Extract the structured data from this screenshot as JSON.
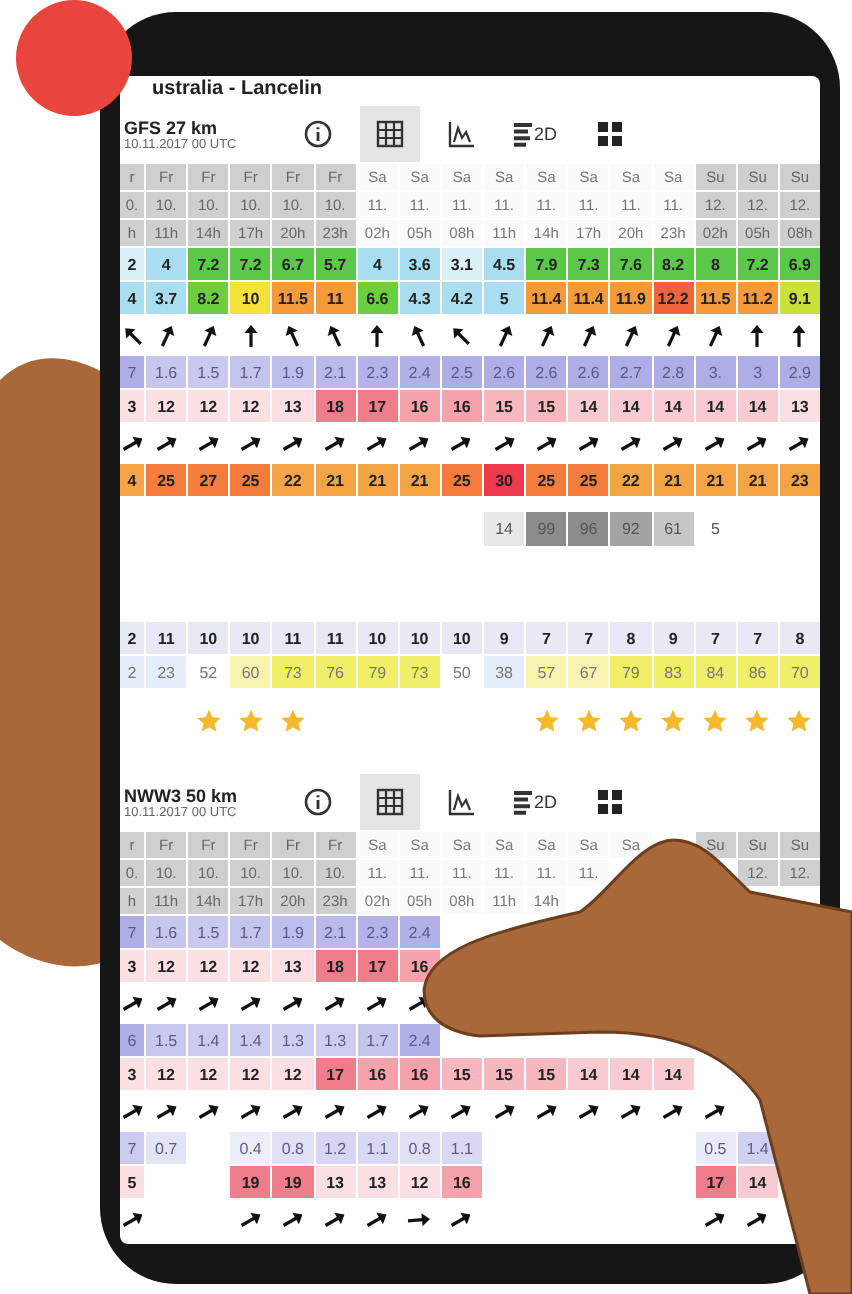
{
  "title": "ustralia - Lancelin",
  "blocks": [
    {
      "model": "GFS 27 km",
      "run": "10.11.2017 00 UTC",
      "tools": [
        {
          "kind": "info",
          "selected": false
        },
        {
          "kind": "table",
          "selected": true
        },
        {
          "kind": "chart",
          "selected": false
        },
        {
          "kind": "bars",
          "label": "2D",
          "selected": false
        },
        {
          "kind": "tiles",
          "selected": false
        }
      ],
      "columns": [
        {
          "day": "r",
          "date": "0.",
          "hour": "h",
          "shaded": true
        },
        {
          "day": "Fr",
          "date": "10.",
          "hour": "11h",
          "shaded": true
        },
        {
          "day": "Fr",
          "date": "10.",
          "hour": "14h",
          "shaded": true
        },
        {
          "day": "Fr",
          "date": "10.",
          "hour": "17h",
          "shaded": true
        },
        {
          "day": "Fr",
          "date": "10.",
          "hour": "20h",
          "shaded": true
        },
        {
          "day": "Fr",
          "date": "10.",
          "hour": "23h",
          "shaded": true
        },
        {
          "day": "Sa",
          "date": "11.",
          "hour": "02h",
          "shaded": false
        },
        {
          "day": "Sa",
          "date": "11.",
          "hour": "05h",
          "shaded": false
        },
        {
          "day": "Sa",
          "date": "11.",
          "hour": "08h",
          "shaded": false
        },
        {
          "day": "Sa",
          "date": "11.",
          "hour": "11h",
          "shaded": false
        },
        {
          "day": "Sa",
          "date": "11.",
          "hour": "14h",
          "shaded": false
        },
        {
          "day": "Sa",
          "date": "11.",
          "hour": "17h",
          "shaded": false
        },
        {
          "day": "Sa",
          "date": "11.",
          "hour": "20h",
          "shaded": false
        },
        {
          "day": "Sa",
          "date": "11.",
          "hour": "23h",
          "shaded": false
        },
        {
          "day": "Su",
          "date": "12.",
          "hour": "02h",
          "shaded": true
        },
        {
          "day": "Su",
          "date": "12.",
          "hour": "05h",
          "shaded": true
        },
        {
          "day": "Su",
          "date": "12.",
          "hour": "08h",
          "shaded": true
        }
      ],
      "rows": [
        {
          "kind": "wind",
          "cells": [
            "2",
            "4",
            "7.2",
            "7.2",
            "6.7",
            "5.7",
            "4",
            "3.6",
            "3.1",
            "4.5",
            "7.9",
            "7.3",
            "7.6",
            "8.2",
            "8",
            "7.2",
            "6.9"
          ]
        },
        {
          "kind": "gust",
          "cells": [
            "4",
            "3.7",
            "8.2",
            "10",
            "11.5",
            "11",
            "6.6",
            "4.3",
            "4.2",
            "5",
            "11.4",
            "11.4",
            "11.9",
            "12.2",
            "11.5",
            "11.2",
            "9.1"
          ]
        },
        {
          "kind": "direction",
          "cells": [
            {
              "kind": "nw"
            },
            {
              "kind": "nne"
            },
            {
              "kind": "nne"
            },
            {
              "kind": "n"
            },
            {
              "kind": "nnw"
            },
            {
              "kind": "nnw"
            },
            {
              "kind": "n"
            },
            {
              "kind": "nnw"
            },
            {
              "kind": "nw"
            },
            {
              "kind": "nne"
            },
            {
              "kind": "nne"
            },
            {
              "kind": "nne"
            },
            {
              "kind": "nne"
            },
            {
              "kind": "nne"
            },
            {
              "kind": "nne"
            },
            {
              "kind": "n"
            },
            {
              "kind": "n"
            }
          ]
        },
        {
          "kind": "wave",
          "cells": [
            "7",
            "1.6",
            "1.5",
            "1.7",
            "1.9",
            "2.1",
            "2.3",
            "2.4",
            "2.5",
            "2.6",
            "2.6",
            "2.6",
            "2.7",
            "2.8",
            "3.",
            "3",
            "2.9"
          ]
        },
        {
          "kind": "period",
          "cells": [
            "3",
            "12",
            "12",
            "12",
            "13",
            "18",
            "17",
            "16",
            "16",
            "15",
            "15",
            "14",
            "14",
            "14",
            "14",
            "14",
            "13"
          ]
        },
        {
          "kind": "direction",
          "cells": [
            {
              "kind": "ene"
            },
            {
              "kind": "ene"
            },
            {
              "kind": "ene"
            },
            {
              "kind": "ene"
            },
            {
              "kind": "ene"
            },
            {
              "kind": "ene"
            },
            {
              "kind": "ene"
            },
            {
              "kind": "ene"
            },
            {
              "kind": "ene"
            },
            {
              "kind": "ene"
            },
            {
              "kind": "ene"
            },
            {
              "kind": "ene"
            },
            {
              "kind": "ene"
            },
            {
              "kind": "ene"
            },
            {
              "kind": "ene"
            },
            {
              "kind": "ene"
            },
            {
              "kind": "ene"
            }
          ]
        },
        {
          "kind": "temp",
          "cells": [
            "4",
            "25",
            "27",
            "25",
            "22",
            "21",
            "21",
            "21",
            "25",
            "30",
            "25",
            "25",
            "22",
            "21",
            "21",
            "21",
            "23"
          ]
        },
        {
          "kind": "cloud",
          "cells": [
            null,
            null,
            null,
            null,
            null,
            null,
            null,
            null,
            null,
            "14",
            "99",
            "96",
            "92",
            "61",
            "5",
            null,
            null
          ]
        },
        {
          "kind": "plain",
          "cells": [
            "2",
            "11",
            "10",
            "10",
            "11",
            "11",
            "10",
            "10",
            "10",
            "9",
            "7",
            "7",
            "8",
            "9",
            "7",
            "7",
            "8"
          ]
        },
        {
          "kind": "humidity",
          "cells": [
            "2",
            "23",
            "52",
            "60",
            "73",
            "76",
            "79",
            "73",
            "50",
            "38",
            "57",
            "67",
            "79",
            "83",
            "84",
            "86",
            "70"
          ]
        },
        {
          "kind": "stars",
          "cells": [
            {
              "rated": false
            },
            {
              "rated": false
            },
            {
              "rated": true
            },
            {
              "rated": true
            },
            {
              "rated": true
            },
            {
              "rated": false
            },
            {
              "rated": false
            },
            {
              "rated": false
            },
            {
              "rated": false
            },
            {
              "rated": false
            },
            {
              "rated": true
            },
            {
              "rated": true
            },
            {
              "rated": true
            },
            {
              "rated": true
            },
            {
              "rated": true
            },
            {
              "rated": true
            },
            {
              "rated": true
            }
          ]
        }
      ]
    },
    {
      "model": "NWW3 50 km",
      "run": "10.11.2017 00 UTC",
      "tools": [
        {
          "kind": "info",
          "selected": false
        },
        {
          "kind": "table",
          "selected": true
        },
        {
          "kind": "chart",
          "selected": false
        },
        {
          "kind": "bars",
          "label": "2D",
          "selected": false
        },
        {
          "kind": "tiles",
          "selected": false
        }
      ],
      "columns": [
        {
          "day": "r",
          "date": "0.",
          "hour": "h",
          "shaded": true
        },
        {
          "day": "Fr",
          "date": "10.",
          "hour": "11h",
          "shaded": true
        },
        {
          "day": "Fr",
          "date": "10.",
          "hour": "14h",
          "shaded": true
        },
        {
          "day": "Fr",
          "date": "10.",
          "hour": "17h",
          "shaded": true
        },
        {
          "day": "Fr",
          "date": "10.",
          "hour": "20h",
          "shaded": true
        },
        {
          "day": "Fr",
          "date": "10.",
          "hour": "23h",
          "shaded": true
        },
        {
          "day": "Sa",
          "date": "11.",
          "hour": "02h",
          "shaded": false
        },
        {
          "day": "Sa",
          "date": "11.",
          "hour": "05h",
          "shaded": false
        },
        {
          "day": "Sa",
          "date": "11.",
          "hour": "08h",
          "shaded": false
        },
        {
          "day": "Sa",
          "date": "11.",
          "hour": "11h",
          "shaded": false
        },
        {
          "day": "Sa",
          "date": "11.",
          "hour": "14h",
          "shaded": false
        },
        {
          "day": "Sa",
          "date": "11.",
          "shaded": false
        },
        {
          "day": "Sa",
          "shaded": false
        },
        {},
        {
          "day": "Su",
          "shaded": true
        },
        {
          "day": "Su",
          "date": "12.",
          "shaded": true
        },
        {
          "day": "Su",
          "date": "12.",
          "shaded": true
        }
      ],
      "rows": [
        {
          "kind": "wave",
          "cells": [
            "7",
            "1.6",
            "1.5",
            "1.7",
            "1.9",
            "2.1",
            "2.3",
            "2.4",
            null,
            null,
            null,
            null,
            null,
            null,
            null,
            null,
            null
          ]
        },
        {
          "kind": "period",
          "cells": [
            "3",
            "12",
            "12",
            "12",
            "13",
            "18",
            "17",
            "16",
            null,
            null,
            null,
            null,
            null,
            null,
            null,
            null,
            null
          ]
        },
        {
          "kind": "direction",
          "cells": [
            {
              "kind": "ene"
            },
            {
              "kind": "ene"
            },
            {
              "kind": "ene"
            },
            {
              "kind": "ene"
            },
            {
              "kind": "ene"
            },
            {
              "kind": "ene"
            },
            {
              "kind": "ene"
            },
            {
              "kind": "ene"
            },
            null,
            null,
            null,
            null,
            null,
            null,
            null,
            null,
            null
          ]
        },
        {
          "kind": "wave",
          "cells": [
            "6",
            "1.5",
            "1.4",
            "1.4",
            "1.3",
            "1.3",
            "1.7",
            "2.4",
            null,
            null,
            null,
            null,
            null,
            null,
            null,
            null,
            null
          ]
        },
        {
          "kind": "period",
          "cells": [
            "3",
            "12",
            "12",
            "12",
            "12",
            "17",
            "16",
            "16",
            "15",
            "15",
            "15",
            "14",
            "14",
            "14",
            null,
            null,
            null
          ]
        },
        {
          "kind": "direction",
          "cells": [
            {
              "kind": "ene"
            },
            {
              "kind": "ene"
            },
            {
              "kind": "ene"
            },
            {
              "kind": "ene"
            },
            {
              "kind": "ene"
            },
            {
              "kind": "ene"
            },
            {
              "kind": "ene"
            },
            {
              "kind": "ene"
            },
            {
              "kind": "ene"
            },
            {
              "kind": "ene"
            },
            {
              "kind": "ene"
            },
            {
              "kind": "ene"
            },
            {
              "kind": "ene"
            },
            {
              "kind": "ene"
            },
            {
              "kind": "ene"
            },
            null,
            null
          ]
        },
        {
          "kind": "swell",
          "cells": [
            "7",
            "0.7",
            null,
            "0.4",
            "0.8",
            "1.2",
            "1.1",
            "0.8",
            "1.1",
            null,
            null,
            null,
            null,
            null,
            "0.5",
            "1.4",
            null
          ]
        },
        {
          "kind": "period",
          "cells": [
            "5",
            null,
            null,
            "19",
            "19",
            "13",
            "13",
            "12",
            "16",
            null,
            null,
            null,
            null,
            null,
            "17",
            "14",
            null
          ]
        },
        {
          "kind": "direction",
          "cells": [
            {
              "kind": "ene"
            },
            null,
            null,
            {
              "kind": "ene"
            },
            {
              "kind": "ene"
            },
            {
              "kind": "ene"
            },
            {
              "kind": "ene"
            },
            {
              "kind": "e"
            },
            {
              "kind": "ene"
            },
            null,
            null,
            null,
            null,
            null,
            {
              "kind": "ene"
            },
            {
              "kind": "ene"
            },
            null
          ]
        }
      ]
    }
  ]
}
